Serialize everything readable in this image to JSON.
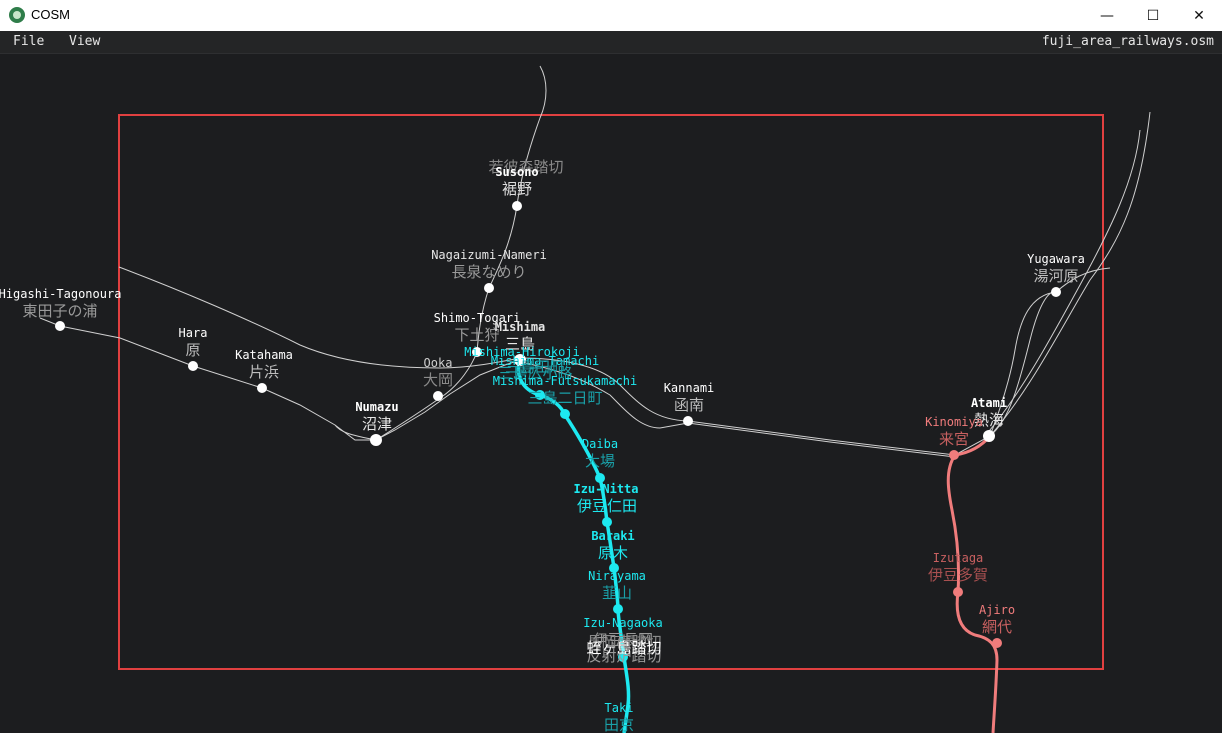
{
  "window": {
    "title": "COSM",
    "minimize_glyph": "—",
    "maximize_glyph": "☐",
    "close_glyph": "✕",
    "app_icon": "cosm-logo-icon"
  },
  "menu": {
    "file": "File",
    "view": "View"
  },
  "file_name": "fuji_area_railways.osm",
  "colors": {
    "background": "#1c1d1f",
    "viewport_frame": "#e04040",
    "jr_line": "#cfcfcf",
    "izu_hakone_line": "#1de9f0",
    "ito_line": "#f07c7c"
  },
  "stations": {
    "susono": {
      "name": "Susono",
      "jp": "裾野",
      "extra": "若彼森踏切"
    },
    "nagaizumi": {
      "name": "Nagaizumi-Nameri",
      "jp": "長泉なめり"
    },
    "shimotogari": {
      "name": "Shimo-Togari",
      "jp": "下土狩"
    },
    "mishima": {
      "name": "Mishima",
      "jp": "三島"
    },
    "mishima_hirokoji": {
      "name": "Mishima-Hirokoji",
      "jp": "三島広小路"
    },
    "mishima_tamachi": {
      "name": "Mishima-Tamachi",
      "jp": "三島田町"
    },
    "mishima_futsukamachi": {
      "name": "Mishima-Futsukamachi",
      "jp": "三島二日町"
    },
    "higashi_tagonoura": {
      "name": "Higashi-Tagonoura",
      "jp": "東田子の浦"
    },
    "hara": {
      "name": "Hara",
      "jp": "原"
    },
    "katahama": {
      "name": "Katahama",
      "jp": "片浜"
    },
    "ooka": {
      "name": "Ooka",
      "jp": "大岡"
    },
    "numazu": {
      "name": "Numazu",
      "jp": "沼津"
    },
    "kannami": {
      "name": "Kannami",
      "jp": "函南"
    },
    "atami": {
      "name": "Atami",
      "jp": "熱海"
    },
    "yugawara": {
      "name": "Yugawara",
      "jp": "湯河原"
    },
    "kinomiya": {
      "name": "Kinomiya",
      "jp": "来宮"
    },
    "izutaga": {
      "name": "Izutaga",
      "jp": "伊豆多賀"
    },
    "ajiro": {
      "name": "Ajiro",
      "jp": "網代"
    },
    "daiba": {
      "name": "Daiba",
      "jp": "大場"
    },
    "izunitta": {
      "name": "Izu-Nitta",
      "jp": "伊豆仁田"
    },
    "baraki": {
      "name": "Baraki",
      "jp": "原木"
    },
    "nirayama": {
      "name": "Nirayama",
      "jp": "韮山"
    },
    "izunagaoka": {
      "name": "Izu-Nagaoka",
      "jp": "伊豆長岡"
    },
    "izunagaoka_extra1": {
      "jp": "長岡南踏切"
    },
    "izunagaoka_extra2": {
      "jp": "反射炉踏切"
    },
    "izunagaoka_extra3": {
      "jp": "蛭ヶ島踏切"
    },
    "taki": {
      "name": "Taki",
      "jp": "田京"
    }
  }
}
